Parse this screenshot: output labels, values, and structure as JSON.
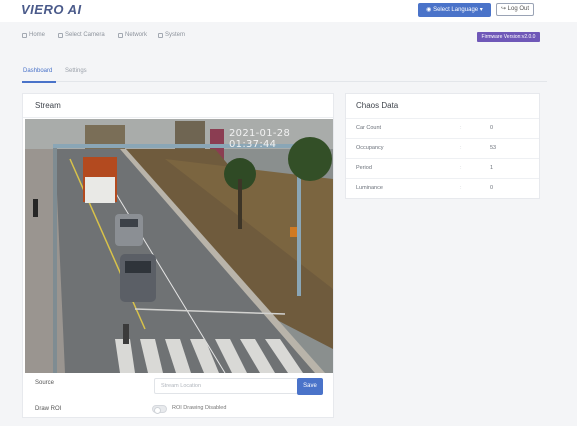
{
  "header": {
    "brand": "VIERO AI",
    "language_button": "Select Language",
    "logout_button": "Log Out"
  },
  "nav": {
    "items": [
      {
        "label": "Home",
        "icon": "home-icon"
      },
      {
        "label": "Select Camera",
        "icon": "camera-icon"
      },
      {
        "label": "Network",
        "icon": "network-icon"
      },
      {
        "label": "System",
        "icon": "system-icon"
      }
    ],
    "firmware_badge": "Firmware Version:v2.0.0"
  },
  "tabs": [
    {
      "label": "Dashboard",
      "active": true
    },
    {
      "label": "Settings",
      "active": false
    }
  ],
  "stream": {
    "title": "Stream",
    "timestamp": "2021-01-28 01:37:44",
    "source_label": "Source",
    "source_placeholder": "Stream Location",
    "save_label": "Save",
    "roi_label": "Draw ROI",
    "roi_toggle_label": "ROI Drawing Disabled"
  },
  "chaos": {
    "title": "Chaos Data",
    "rows": [
      {
        "name": "Car Count",
        "sep": ":",
        "value": "0"
      },
      {
        "name": "Occupancy",
        "sep": ":",
        "value": "53"
      },
      {
        "name": "Period",
        "sep": ":",
        "value": "1"
      },
      {
        "name": "Luminance",
        "sep": ":",
        "value": "0"
      }
    ]
  },
  "colors": {
    "accent": "#4a73c9",
    "badge": "#6f58b8"
  }
}
